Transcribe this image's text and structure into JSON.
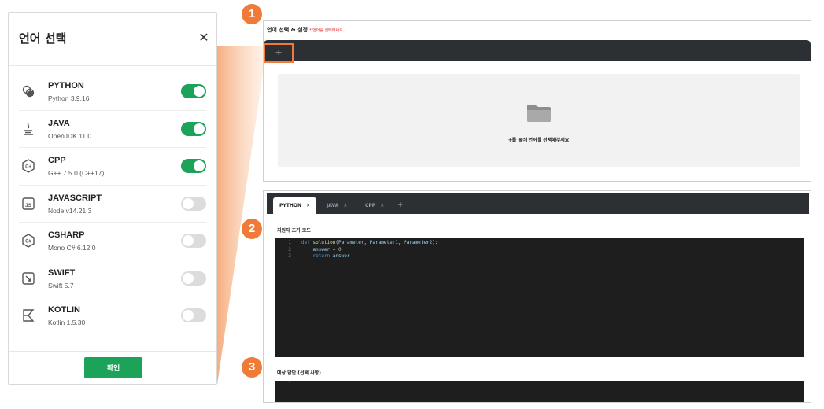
{
  "modal": {
    "title": "언어 선택",
    "close_icon": "close-icon",
    "languages": [
      {
        "name": "PYTHON",
        "version": "Python 3.9.16",
        "enabled": true,
        "icon": "python-icon"
      },
      {
        "name": "JAVA",
        "version": "OpenJDK 11.0",
        "enabled": true,
        "icon": "java-icon"
      },
      {
        "name": "CPP",
        "version": "G++ 7.5.0 (C++17)",
        "enabled": true,
        "icon": "cpp-icon"
      },
      {
        "name": "JAVASCRIPT",
        "version": "Node v14.21.3",
        "enabled": false,
        "icon": "javascript-icon"
      },
      {
        "name": "CSHARP",
        "version": "Mono C# 6.12.0",
        "enabled": false,
        "icon": "csharp-icon"
      },
      {
        "name": "SWIFT",
        "version": "Swift 5.7",
        "enabled": false,
        "icon": "swift-icon"
      },
      {
        "name": "KOTLIN",
        "version": "Kotlin 1.5.30",
        "enabled": false,
        "icon": "kotlin-icon"
      }
    ],
    "confirm_label": "확인"
  },
  "badges": {
    "one": "1",
    "two": "2",
    "three": "3"
  },
  "panel_language": {
    "title": "언어 선택 & 설정",
    "hint": "* 언어를 선택하세요",
    "add_tab": "+",
    "empty_message": "+를 눌러 언어를 선택해주세요"
  },
  "panel_code": {
    "tabs": [
      {
        "label": "PYTHON",
        "close": "×",
        "active": true
      },
      {
        "label": "JAVA",
        "close": "×",
        "active": false
      },
      {
        "label": "CPP",
        "close": "×",
        "active": false
      }
    ],
    "add_tab": "+",
    "initial_code_label": "지원자 초기 코드",
    "initial_code": [
      {
        "num": "1",
        "text": "def solution(Parameter, Parameter1, Parameter2):"
      },
      {
        "num": "2",
        "text": "    answer = 0"
      },
      {
        "num": "3",
        "text": "    return answer"
      }
    ],
    "expected_answer_label": "예상 답안 (선택 사항)",
    "expected_code": [
      {
        "num": "1",
        "text": ""
      }
    ]
  },
  "colors": {
    "accent_orange": "#f07b38",
    "toggle_on": "#1ba35a",
    "editor_bg": "#1e1e1e",
    "tabbar_bg": "#2c2f33"
  }
}
